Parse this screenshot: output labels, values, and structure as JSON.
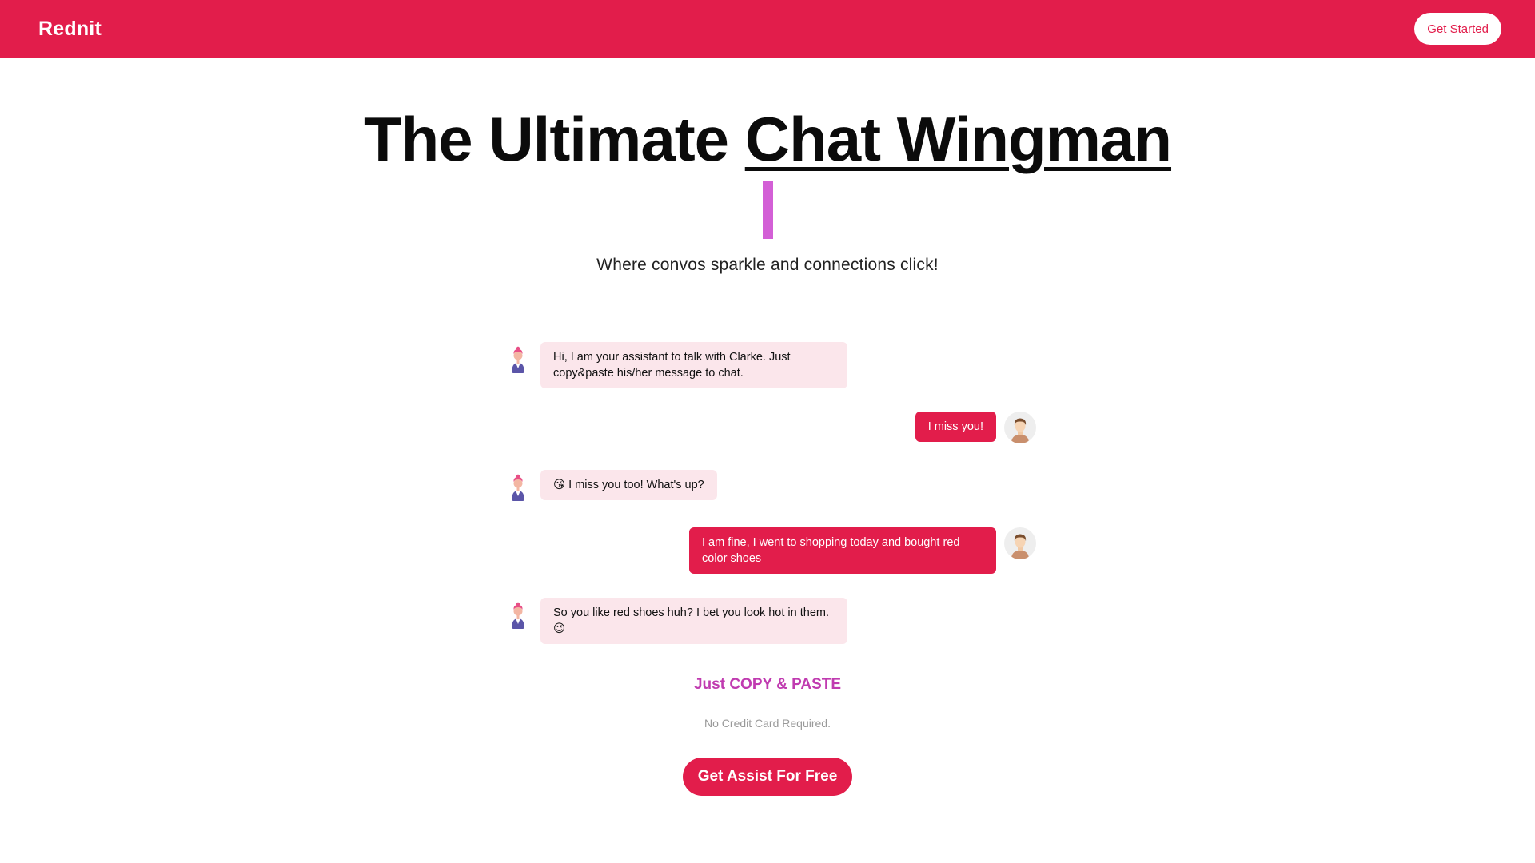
{
  "nav": {
    "brand": "Rednit",
    "cta_label": "Get Started",
    "background_color": "#e21d4b"
  },
  "hero": {
    "title_plain": "The Ultimate ",
    "title_highlight": "Chat Wingman",
    "subtitle": "Where convos sparkle and connections click!",
    "caret_color": "#d35fd6"
  },
  "chat": {
    "messages": [
      {
        "sender": "bot",
        "avatar_icon": "assistant-avatar-icon",
        "text": "Hi, I am your assistant to talk with Clarke. Just copy&paste his/her message to chat."
      },
      {
        "sender": "user",
        "avatar_icon": "user-avatar-icon",
        "text": "I miss you!"
      },
      {
        "sender": "bot",
        "avatar_icon": "assistant-avatar-icon",
        "text": "😘 I miss you too! What's up?"
      },
      {
        "sender": "user",
        "avatar_icon": "user-avatar-icon",
        "text": "I am fine, I went to shopping today and bought red color shoes"
      },
      {
        "sender": "bot",
        "avatar_icon": "assistant-avatar-icon",
        "text": "So you like red shoes huh? I bet you look hot in them. 😉"
      }
    ],
    "bot_bubble_color": "#fbe6eb",
    "user_bubble_color": "#e21d4b"
  },
  "cta": {
    "heading": "Just COPY & PASTE",
    "note": "No Credit Card Required.",
    "button_label": "Get Assist For Free",
    "heading_color": "#c03bb0"
  }
}
